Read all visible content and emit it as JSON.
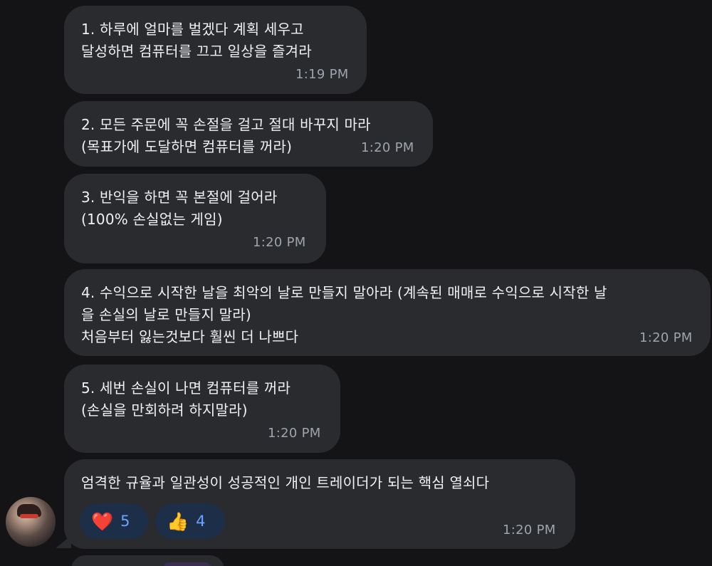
{
  "messages": [
    {
      "text": "1. 하루에 얼마를 벌겠다 계획 세우고\n달성하면 컴퓨터를 끄고 일상을 즐겨라",
      "time": "1:19 PM"
    },
    {
      "text": "2. 모든 주문에 꼭 손절을 걸고 절대 바꾸지 마라\n(목표가에 도달하면 컴퓨터를 꺼라)",
      "time": "1:20 PM"
    },
    {
      "text": "3. 반익을 하면 꼭 본절에 걸어라\n(100% 손실없는 게임)",
      "time": "1:20 PM"
    },
    {
      "text": "4. 수익으로 시작한 날을 최악의 날로 만들지 말아라 (계속된 매매로 수익으로 시작한 날\n을 손실의 날로 만들지 말라)\n처음부터 잃는것보다 훨씬 더 나쁘다",
      "time": "1:20 PM"
    },
    {
      "text": "5. 세번 손실이 나면 컴퓨터를 꺼라\n(손실을 만회하려 하지말라)",
      "time": "1:20 PM"
    },
    {
      "text": "엄격한 규율과 일관성이 성공적인 개인 트레이더가 되는 핵심 열쇠다",
      "time": "1:20 PM",
      "reactions": [
        {
          "icon": "heart-icon",
          "emoji": "❤️",
          "count": "5"
        },
        {
          "icon": "thumbs-up-icon",
          "emoji": "👍",
          "count": "4"
        }
      ]
    }
  ],
  "colors": {
    "background": "#141416",
    "bubble": "#2a2b2f",
    "reaction_bg": "#1c2e48",
    "reaction_text": "#6aa4ff",
    "time": "#9ea3ad"
  }
}
